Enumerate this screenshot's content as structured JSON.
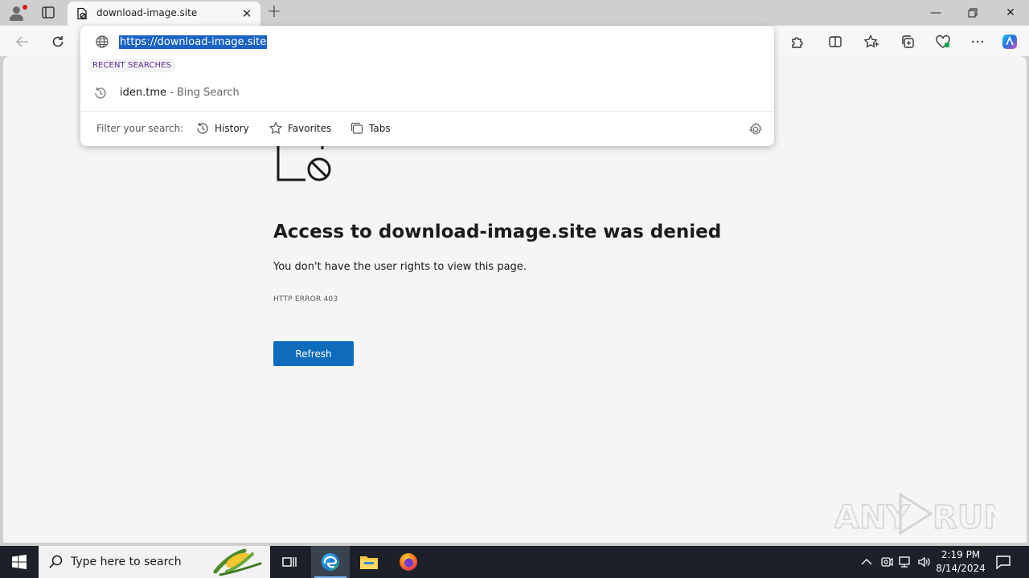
{
  "browser": {
    "tab": {
      "title": "download-image.site",
      "favicon": "page-lock-icon"
    },
    "window_controls": [
      "minimize-icon",
      "restore-icon",
      "close-icon"
    ]
  },
  "address_dropdown": {
    "url": "https://download-image.site",
    "recent_label": "RECENT SEARCHES",
    "suggestions": [
      {
        "query": "iden.tme",
        "source": " - Bing Search"
      }
    ],
    "filter_label": "Filter your search:",
    "filters": [
      {
        "label": "History",
        "icon": "history-icon"
      },
      {
        "label": "Favorites",
        "icon": "star-icon"
      },
      {
        "label": "Tabs",
        "icon": "tabs-icon"
      }
    ]
  },
  "page": {
    "title": "Access to download-image.site was denied",
    "description": "You don't have the user rights to view this page.",
    "error_code": "HTTP ERROR 403",
    "refresh_label": "Refresh",
    "watermark": "ANY RUN"
  },
  "taskbar": {
    "search_placeholder": "Type here to search",
    "time": "2:19 PM",
    "date": "8/14/2024"
  },
  "colors": {
    "accent": "#0f6cbd",
    "selection": "#1a62c4",
    "taskbar": "#1c2029"
  }
}
